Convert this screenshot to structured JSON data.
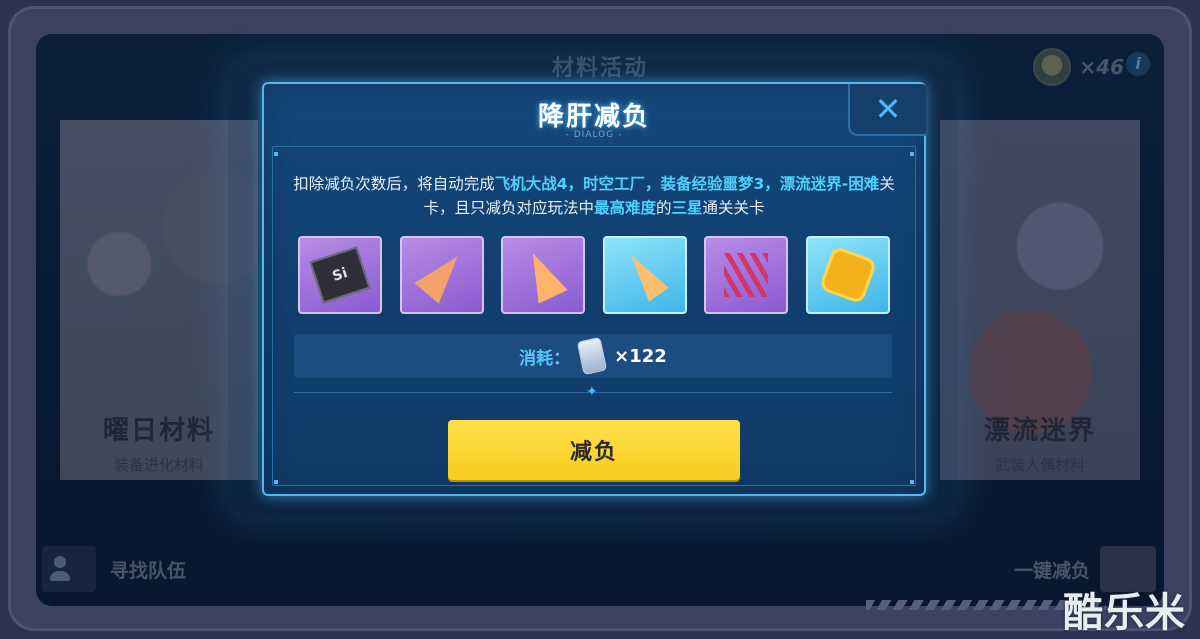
{
  "background": {
    "screen_title": "材料活动",
    "currency_count": "×46",
    "info_label": "i",
    "left_card": {
      "title": "曜日材料",
      "subtitle": "装备进化材料"
    },
    "right_card": {
      "title": "漂流迷界",
      "subtitle": "武装人偶材料"
    },
    "find_team_label": "寻找队伍",
    "one_click_label": "一键减负"
  },
  "dialog": {
    "title": "降肝减负",
    "subtitle": "- DIALOG -",
    "close_label": "✕",
    "description_parts": [
      {
        "text": "扣除减负次数后，将自动完成",
        "highlight": false
      },
      {
        "text": "飞机大战4，时空工厂，装备经验噩梦3，漂流迷界-困难",
        "highlight": true
      },
      {
        "text": "关卡，且只减负对应玩法中",
        "highlight": false
      },
      {
        "text": "最高难度",
        "highlight": true
      },
      {
        "text": "的",
        "highlight": false
      },
      {
        "text": "三星",
        "highlight": true
      },
      {
        "text": "通关关卡",
        "highlight": false
      }
    ],
    "rewards": [
      {
        "icon": "chip-icon",
        "chip_text": "Si",
        "rarity": "purple"
      },
      {
        "icon": "crystal-shard-icon",
        "rarity": "purple"
      },
      {
        "icon": "twin-shard-icon",
        "rarity": "purple"
      },
      {
        "icon": "shard-fragment-icon",
        "rarity": "blue"
      },
      {
        "icon": "red-rods-icon",
        "rarity": "purple"
      },
      {
        "icon": "gold-coin-icon",
        "rarity": "blue"
      }
    ],
    "cost_label": "消耗：",
    "cost_amount": "×122",
    "confirm_label": "减负"
  },
  "watermark": "酷乐米",
  "colors": {
    "accent": "#4fd0ff",
    "button": "#f8cc1f",
    "dialog_border": "#57b7f0"
  }
}
